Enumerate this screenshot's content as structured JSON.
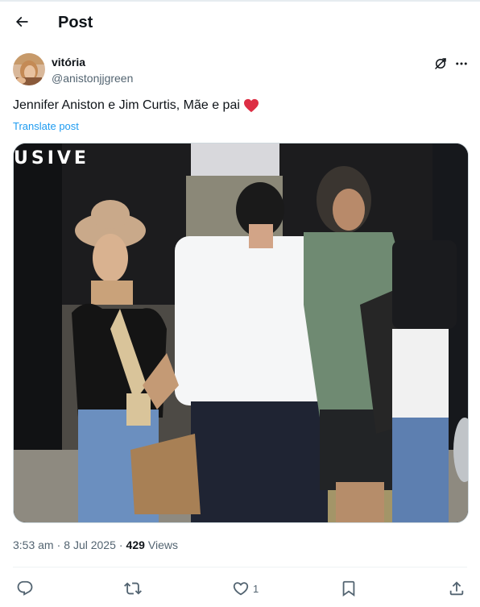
{
  "header": {
    "title": "Post",
    "back_icon": "arrow-left-icon"
  },
  "author": {
    "display_name": "vitória",
    "handle": "@anistonjjgreen"
  },
  "post": {
    "text": "Jennifer Aniston e Jim Curtis, Mãe e pai",
    "emoji": "red-heart-emoji",
    "translate_label": "Translate post",
    "media_watermark": "USIVE"
  },
  "meta": {
    "time": "3:53 am",
    "date": "8 Jul 2025",
    "views_count": "429",
    "views_label": "Views",
    "separator": "·"
  },
  "actions": {
    "reply_count": "",
    "repost_count": "",
    "like_count": "1",
    "bookmark_count": ""
  },
  "colors": {
    "accent": "#1d9bf0",
    "text_primary": "#0f1419",
    "text_secondary": "#536471",
    "heart": "#e0245e"
  }
}
